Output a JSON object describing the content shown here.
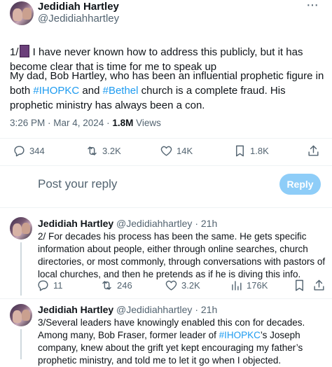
{
  "main_tweet": {
    "author_name": "Jedidiah Hartley",
    "author_handle": "@Jedidiahhartley",
    "more_label": "···",
    "line1_prefix": "1/",
    "line1_rest": " I have never known how to address this publicly, but it has become clear that is time for me to speak up",
    "para2_a": "My dad, Bob Hartley, who has been an influential prophetic figure in both ",
    "hashtag1": "#IHOPKC",
    "para2_b": " and ",
    "hashtag2": "#Bethel",
    "para2_c": " church is a complete fraud. His prophetic ministry has always been a con.",
    "time": "3:26 PM · Mar 4, 2024 · ",
    "views_count": "1.8M",
    "views_label": " Views",
    "stats": {
      "replies": "344",
      "retweets": "3.2K",
      "likes": "14K",
      "bookmarks": "1.8K"
    }
  },
  "reply_box": {
    "placeholder": "Post your reply",
    "button_label": "Reply"
  },
  "replies": [
    {
      "author_name": "Jedidiah Hartley",
      "author_handle": "@Jedidiahhartley",
      "time": "· 21h",
      "text": "2/ For decades his process has been the same. He gets specific information about people, either through online searches, church directories, or most commonly, through conversations with pastors of local churches, and then he pretends as if he is diving this info.",
      "stats": {
        "replies": "11",
        "retweets": "246",
        "likes": "3.2K",
        "views": "176K"
      }
    },
    {
      "author_name": "Jedidiah Hartley",
      "author_handle": "@Jedidiahhartley",
      "time": "· 21h",
      "text_a": "3/Several leaders have knowingly enabled this con for decades. Among many, Bob Fraser, former leader of ",
      "hashtag": "#IHOPKC",
      "text_b": "’s Joseph company, knew about the grift yet kept encouraging my father’s prophetic ministry, and told me to let it go when I objected."
    }
  ],
  "colors": {
    "link": "#1d9bf0",
    "muted": "#536471",
    "reply_button": "#8ecdf8"
  }
}
